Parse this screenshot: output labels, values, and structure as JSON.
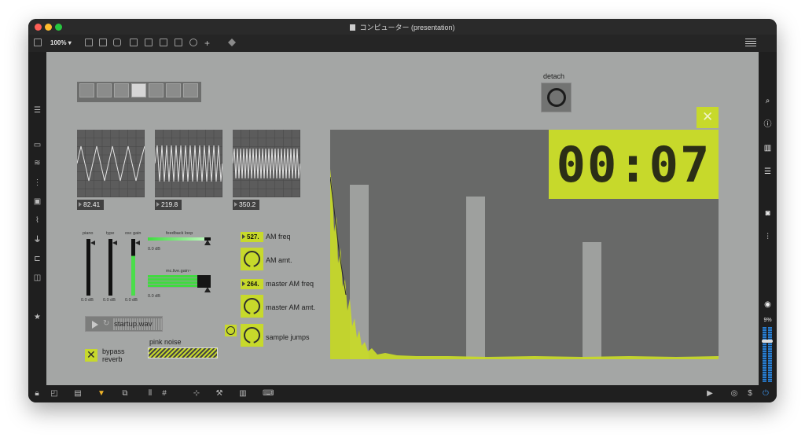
{
  "window": {
    "title": "コンピューター (presentation)",
    "zoom": "100%"
  },
  "colors": {
    "accent": "#c7d92b",
    "canvas": "#a4a6a5",
    "chrome": "#1e1e1e",
    "close": "#ff5f57",
    "minimize": "#febc2e",
    "maximize": "#28c840"
  },
  "toolbar": {
    "icons": [
      "sidebar-toggle-icon",
      "comment-icon",
      "message-icon",
      "toggle-icon",
      "bang-icon",
      "number-icon",
      "slider-icon",
      "dial-icon",
      "plus-icon",
      "paint-bucket-icon",
      "grid-menu-icon"
    ]
  },
  "sidebar_left": {
    "icons": [
      "menu-icon",
      "device-icon",
      "waveform-icon",
      "cue-icon",
      "image-icon",
      "paperclip-icon",
      "plug-icon",
      "loop-icon",
      "frame-icon",
      "star-icon"
    ]
  },
  "sidebar_right": {
    "icons": [
      "search-icon",
      "info-icon",
      "book-icon",
      "list-icon",
      "camera-icon",
      "mixer-icon",
      "disc-icon"
    ],
    "cpu": "9%"
  },
  "bottombar": {
    "icons": [
      "lock-icon",
      "presentation-icon",
      "patcher-icon",
      "highlight-icon",
      "windows-icon",
      "split-icon",
      "grid-icon",
      "add-object-icon",
      "wrench-icon",
      "keyboard-icon",
      "midi-keyboard-icon",
      "play-audio-icon",
      "mixer-mode-icon",
      "dollar-icon",
      "power-icon"
    ]
  },
  "selector": {
    "count": 7,
    "selected": 3
  },
  "detach": {
    "label": "detach"
  },
  "scopes": [
    {
      "value": "82.41"
    },
    {
      "value": "219.8"
    },
    {
      "value": "350.2"
    }
  ],
  "mixer": {
    "labels": [
      "piano",
      "type",
      "osc gain"
    ],
    "values": [
      "0.0 dB",
      "0.0 dB",
      "0.0 dB"
    ],
    "feedback_label": "feedback loop",
    "feedback_value": "0.0 dB",
    "mc_label": "mc.live.gain~",
    "mc_value": "0.0 dB"
  },
  "player": {
    "file": "startup.wav"
  },
  "bypass": {
    "label_1": "bypass",
    "label_2": "reverb"
  },
  "noise": {
    "label": "pink noise"
  },
  "controls": {
    "am_freq_value": "527.",
    "am_freq_label": "AM freq",
    "am_amt_label": "AM amt.",
    "master_am_freq_value": "264.",
    "master_am_freq_label": "master AM freq",
    "master_am_amt_label": "master AM amt.",
    "sample_jumps_label": "sample jumps"
  },
  "timer": {
    "display": "00:07"
  }
}
